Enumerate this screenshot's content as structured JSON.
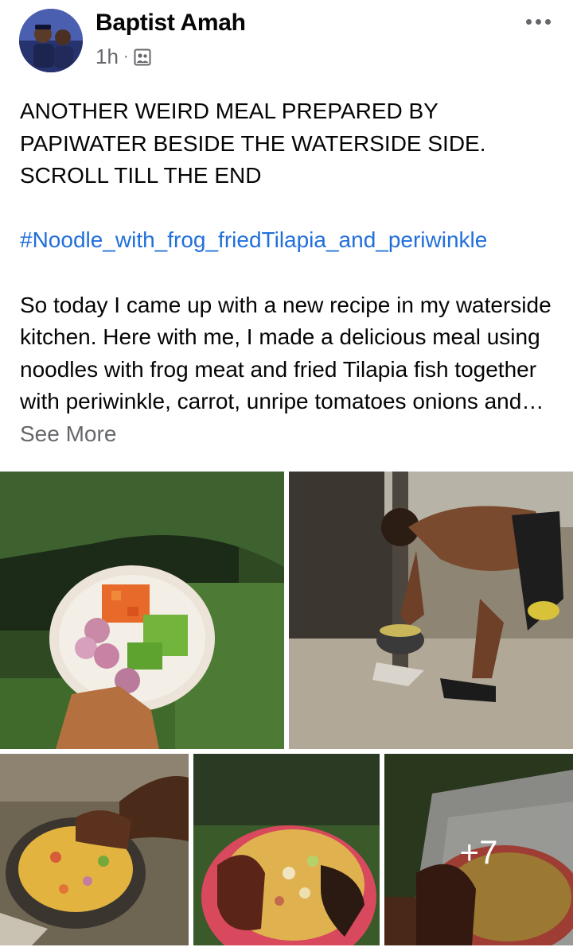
{
  "post": {
    "author": "Baptist Amah",
    "time": "1h",
    "dot": "·",
    "audience_icon": "group-icon",
    "more_icon": "more-horizontal-icon"
  },
  "text": {
    "line1": "ANOTHER  WEIRD MEAL PREPARED BY PAPIWATER BESIDE THE WATERSIDE SIDE. SCROLL TILL THE END",
    "hashtag": "#Noodle_with_frog_friedTilapia_and_periwinkle",
    "body": "So today I came up with a new recipe in my waterside kitchen. Here with me, I made a delicious meal using noodles with frog meat and fried Tilapia fish together with periwinkle, carrot, unripe tomatoes onions and",
    "ellipsis": "… ",
    "see_more": "See More"
  },
  "photos": {
    "count_label": "+7",
    "items": [
      {
        "alt": "plate of chopped vegetables"
      },
      {
        "alt": "man cooking by the waterside"
      },
      {
        "alt": "pot of noodles"
      },
      {
        "alt": "noodles with fried fish"
      },
      {
        "alt": "tray with fried fish"
      }
    ]
  },
  "colors": {
    "link": "#216fdb",
    "secondary_text": "#65676b"
  }
}
